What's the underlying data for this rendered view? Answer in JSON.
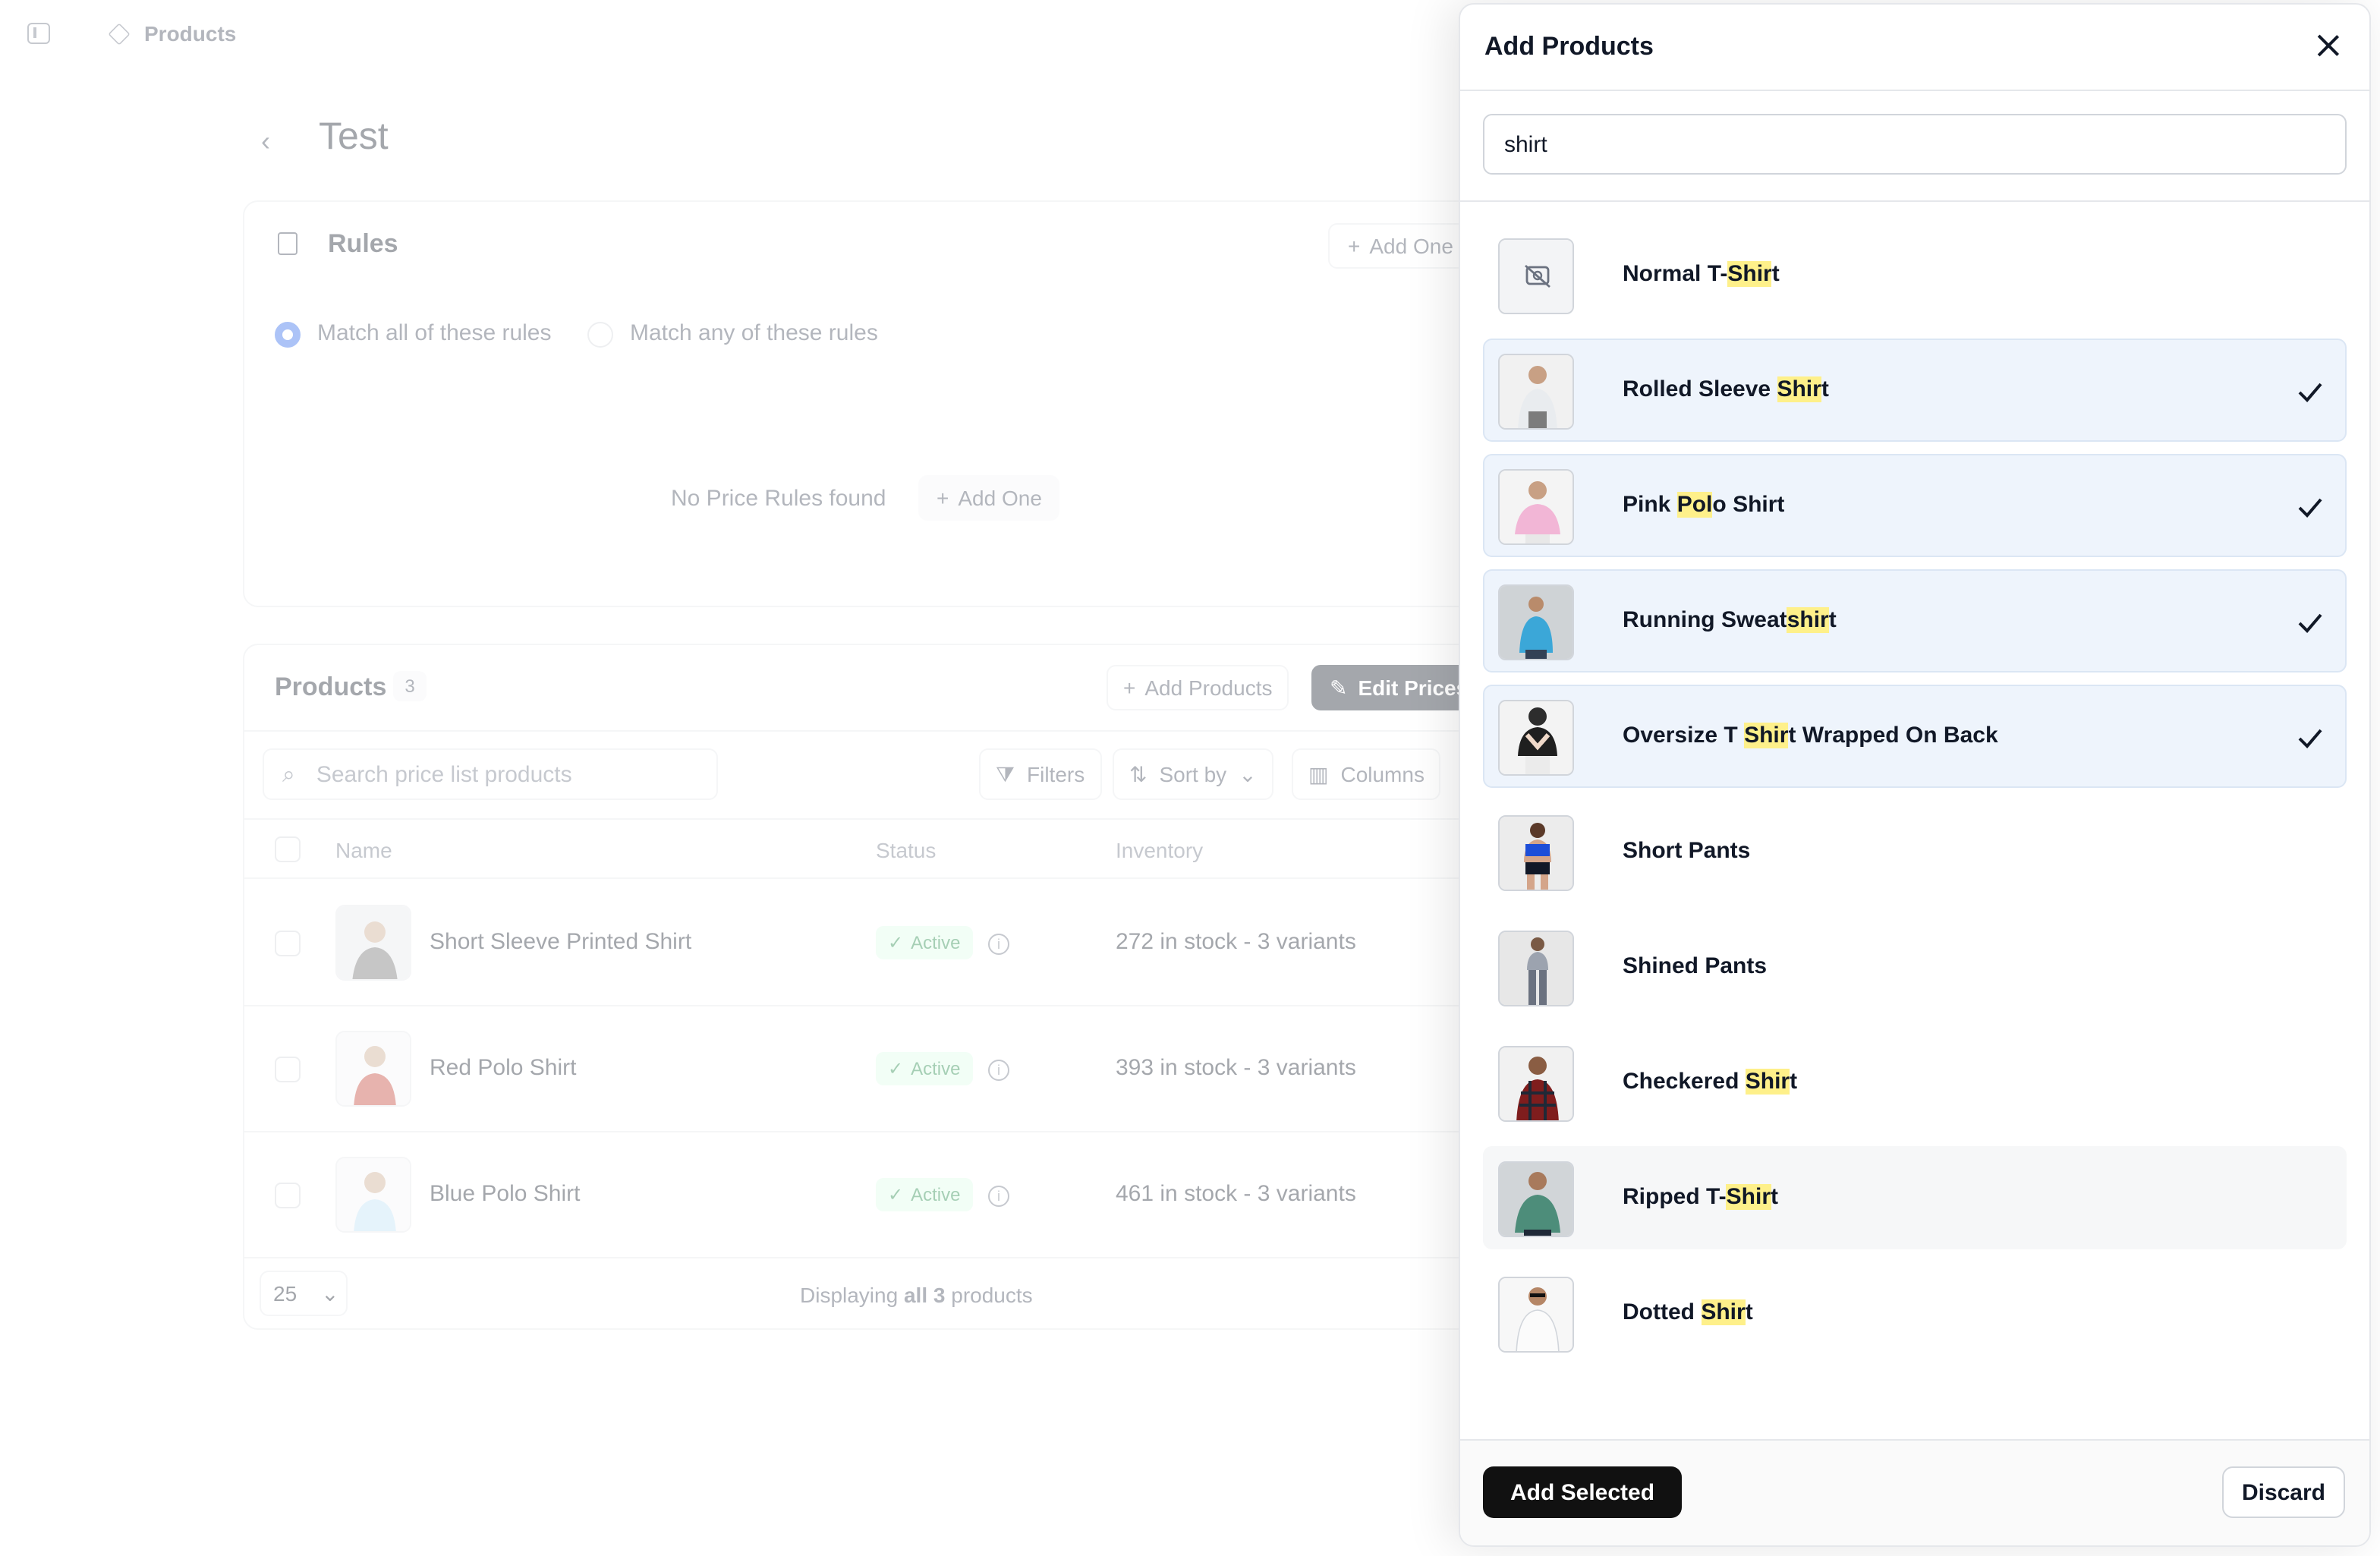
{
  "topbar": {
    "breadcrumb": "Products"
  },
  "page": {
    "title": "Test"
  },
  "rules": {
    "title": "Rules",
    "add_one_label": "Add One",
    "match_all_label": "Match all of these rules",
    "match_any_label": "Match any of these rules",
    "empty_text": "No Price Rules found",
    "empty_add_label": "Add One"
  },
  "products": {
    "title": "Products",
    "count": "3",
    "add_products_label": "Add Products",
    "edit_prices_label": "Edit Prices",
    "search_placeholder": "Search price list products",
    "filters_label": "Filters",
    "sort_label": "Sort by",
    "columns_label": "Columns",
    "headers": {
      "name": "Name",
      "status": "Status",
      "inventory": "Inventory"
    },
    "rows": [
      {
        "name": "Short Sleeve Printed Shirt",
        "status": "Active",
        "inventory": "272 in stock - 3 variants"
      },
      {
        "name": "Red Polo Shirt",
        "status": "Active",
        "inventory": "393 in stock - 3 variants"
      },
      {
        "name": "Blue Polo Shirt",
        "status": "Active",
        "inventory": "461 in stock - 3 variants"
      }
    ],
    "page_size": "25",
    "footer_prefix": "Displaying ",
    "footer_bold": "all 3",
    "footer_suffix": " products"
  },
  "modal": {
    "title": "Add Products",
    "search_value": "shirt",
    "add_selected_label": "Add Selected",
    "discard_label": "Discard",
    "items": [
      {
        "pre": "Normal T-",
        "match": "Shir",
        "post": "t",
        "selected": false,
        "image": "placeholder"
      },
      {
        "pre": "Rolled Sleeve ",
        "match": "Shir",
        "post": "t",
        "selected": true,
        "image": "white-shirt-person"
      },
      {
        "pre": "Pink ",
        "match": "Pol",
        "post": "o Shirt",
        "selected": true,
        "image": "pink-shirt-person"
      },
      {
        "pre": "Running Sweat",
        "match": "shir",
        "post": "t",
        "selected": true,
        "image": "blue-sweatshirt-person"
      },
      {
        "pre": "Oversize T ",
        "match": "Shir",
        "post": "t Wrapped On Back",
        "selected": true,
        "image": "black-top-person"
      },
      {
        "pre": "Short Pants",
        "match": "",
        "post": "",
        "selected": false,
        "image": "shorts-person"
      },
      {
        "pre": "Shined Pants",
        "match": "",
        "post": "",
        "selected": false,
        "image": "pants-person"
      },
      {
        "pre": "Checkered ",
        "match": "Shir",
        "post": "t",
        "selected": false,
        "image": "plaid-shirt-person"
      },
      {
        "pre": "Ripped T-",
        "match": "Shir",
        "post": "t",
        "selected": false,
        "image": "green-tshirt-person"
      },
      {
        "pre": "Dotted ",
        "match": "Shir",
        "post": "t",
        "selected": false,
        "image": "white-dotted-shirt-person"
      }
    ]
  },
  "colors": {
    "accent": "#2563eb",
    "highlight": "#fef08a",
    "selected_bg": "#eef4fc",
    "primary_button": "#111111"
  }
}
